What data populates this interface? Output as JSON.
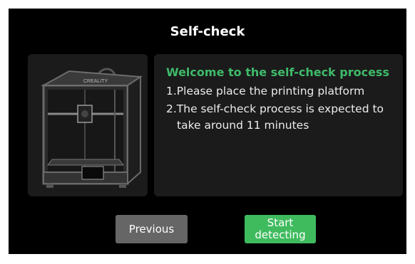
{
  "header": {
    "title": "Self-check"
  },
  "content": {
    "welcome": "Welcome to the self-check process",
    "step1": "1.Please place the printing platform",
    "step2_line1": "2.The self-check process is expected to",
    "step2_line2": "take around 11 minutes"
  },
  "printer_image": {
    "brand_text": "CREALITY"
  },
  "buttons": {
    "previous": "Previous",
    "start_line1": "Start",
    "start_line2": "detecting"
  },
  "colors": {
    "accent_green": "#3fba6a",
    "button_green": "#3fbb5e",
    "button_gray": "#666666",
    "panel": "#1b1b1b",
    "screen": "#000000"
  }
}
